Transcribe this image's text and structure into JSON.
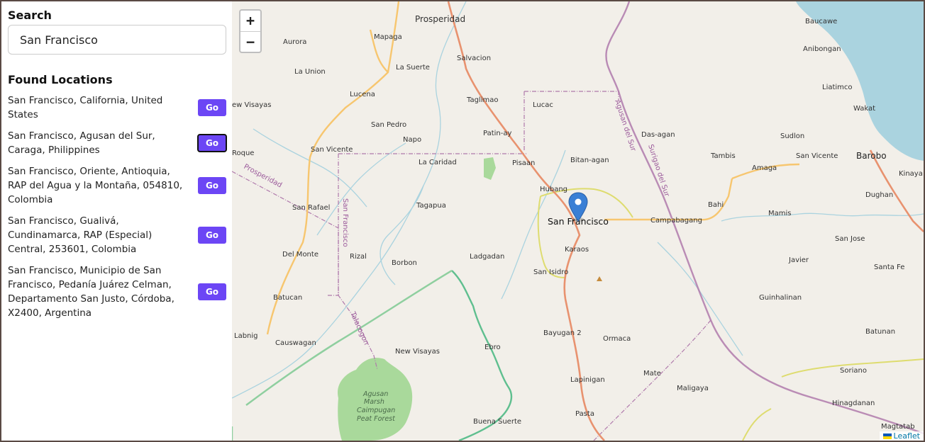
{
  "sidebar": {
    "search_heading": "Search",
    "search_value": "San Francisco",
    "found_heading": "Found Locations",
    "go_label": "Go",
    "results": [
      {
        "text": "San Francisco, California, United States"
      },
      {
        "text": "San Francisco, Agusan del Sur, Caraga, Philippines"
      },
      {
        "text": "San Francisco, Oriente, Antioquia, RAP del Agua y la Montaña, 054810, Colombia"
      },
      {
        "text": "San Francisco, Gualivá, Cundinamarca, RAP (Especial) Central, 253601, Colombia"
      },
      {
        "text": "San Francisco, Municipio de San Francisco, Pedanía Juárez Celman, Departamento San Justo, Córdoba, X2400, Argentina"
      }
    ]
  },
  "map": {
    "zoom_in": "+",
    "zoom_out": "−",
    "attribution": "Leaflet",
    "marker_label": "San Francisco",
    "places": {
      "prosperidad": "Prosperidad",
      "aurora": "Aurora",
      "mapaga": "Mapaga",
      "salvacion": "Salvacion",
      "la_union": "La Union",
      "la_suerte": "La Suerte",
      "lucena": "Lucena",
      "taglimao": "Taglimao",
      "lucac": "Lucac",
      "new_visayas_w": "ew Visayas",
      "san_pedro": "San Pedro",
      "patin_ay": "Patin-ay",
      "napo": "Napo",
      "san_vicente_w": "San Vicente",
      "roque": "Roque",
      "la_caridad": "La Caridad",
      "pisaan": "Pisaan",
      "bitan_agan": "Bitan-agan",
      "das_agan": "Das-agan",
      "hubang": "Hubang",
      "tagapua": "Tagapua",
      "san_rafael": "San Rafael",
      "karaos": "Karaos",
      "ladgadan": "Ladgadan",
      "rizal": "Rizal",
      "del_monte": "Del Monte",
      "borbon": "Borbon",
      "san_isidro": "San Isidro",
      "batucan": "Batucan",
      "bayugan_2": "Bayugan 2",
      "ormaca": "Ormaca",
      "labnig": "Labnig",
      "causwagan": "Causwagan",
      "ebro": "Ebro",
      "new_visayas_s": "New Visayas",
      "mate": "Mate",
      "lapinigan": "Lapinigan",
      "maligaya": "Maligaya",
      "pasta": "Pasta",
      "buena_suerte": "Buena Suerte",
      "baucawe": "Baucawe",
      "anibongan": "Anibongan",
      "liatimco": "Liatimco",
      "wakat": "Wakat",
      "sudlon": "Sudlon",
      "tambis": "Tambis",
      "amaga": "Amaga",
      "san_vicente_e": "San Vicente",
      "barobo": "Barobo",
      "kinaya": "Kinaya",
      "dughan": "Dughan",
      "bahi": "Bahi",
      "mamis": "Mamis",
      "campabagang": "Campabagang",
      "san_jose": "San Jose",
      "javier": "Javier",
      "santa_fe": "Santa Fe",
      "guinhalinan": "Guinhalinan",
      "batunan": "Batunan",
      "soriano": "Soriano",
      "hinagdanan": "Hinagdanan",
      "magtatab": "Magtatab"
    },
    "road_labels": {
      "prosperidad_road": "Prosperidad",
      "san_francisco_road": "San Francisco",
      "talacogon": "Talacogon",
      "agusan_del_sur": "Agusan del Sur",
      "surigao_del_sur": "Surigao del Sur"
    },
    "park_label": [
      "Agusan",
      "Marsh",
      "Caimpugan",
      "Peat Forest"
    ],
    "colors": {
      "land": "#f2efe9",
      "water": "#aad3df",
      "main_road": "#e8926f",
      "secondary_road": "#f7c66f",
      "tertiary_road": "#e2e87a",
      "park": "#a9d99b",
      "boundary": "#b07aac",
      "marker": "#3a7fd5",
      "button": "#6c46f5"
    }
  }
}
